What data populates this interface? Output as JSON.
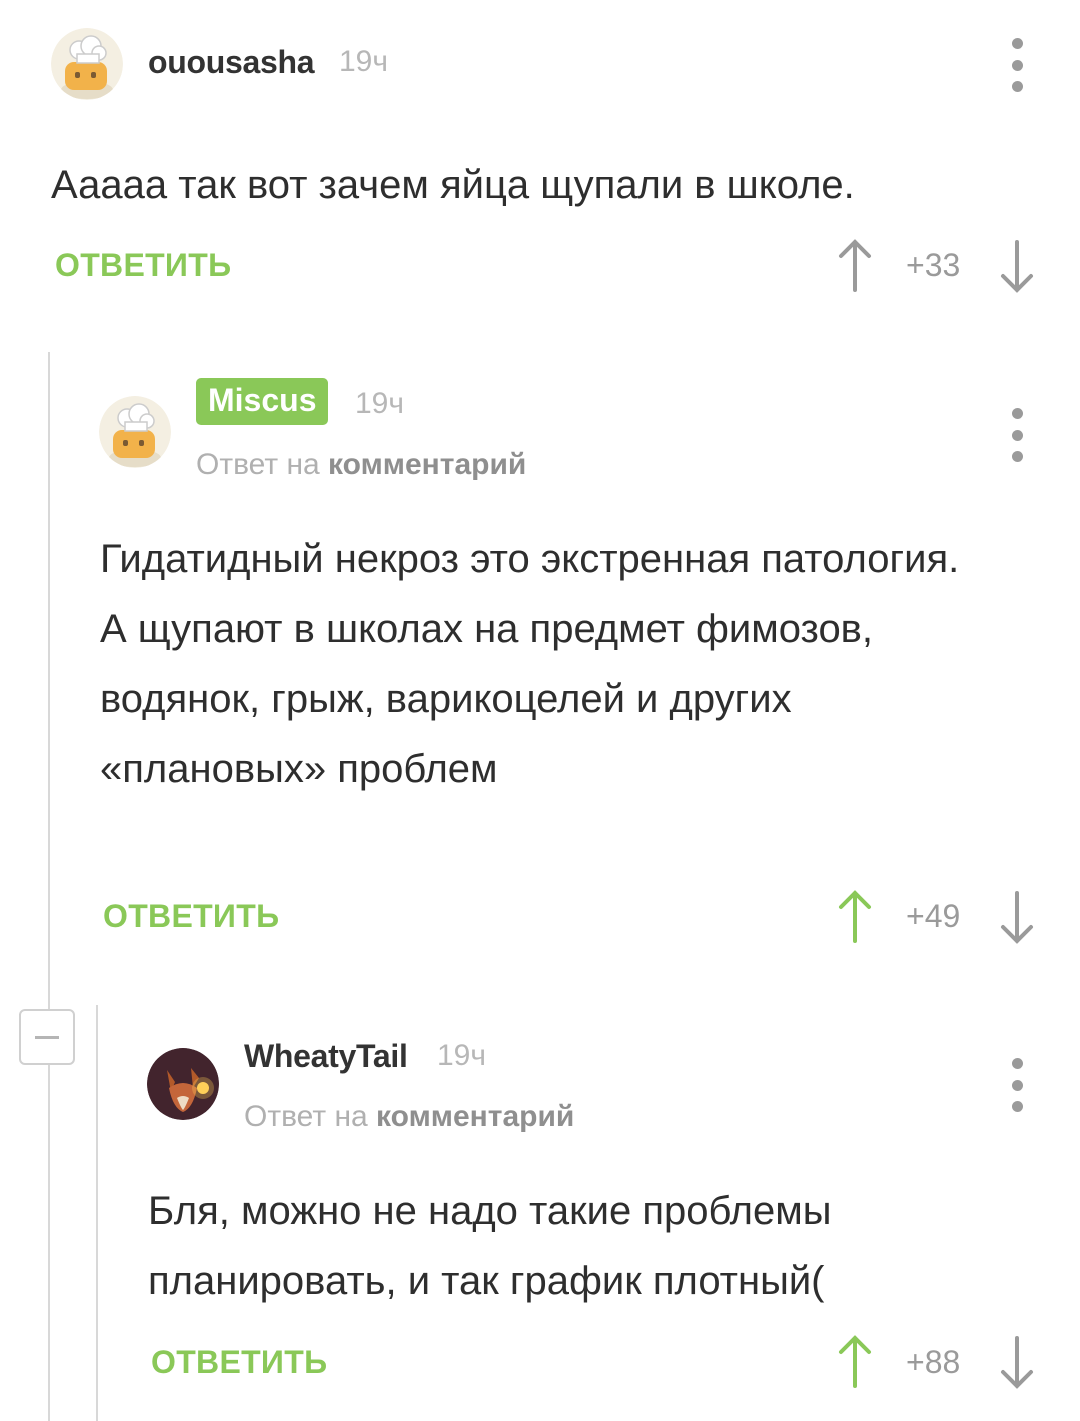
{
  "comments": [
    {
      "author": "ouousasha",
      "time": "19ч",
      "text": "Ааааа так вот зачем яйца щупали в школе.",
      "reply_label": "ОТВЕТИТЬ",
      "rating": "+33",
      "avatar_icon": "chef-hat-avatar"
    },
    {
      "author": "Miscus",
      "time": "19ч",
      "reply_prefix": "Ответ на",
      "reply_link": "комментарий",
      "text": "Гидатидный некроз это экстренная патология. А щупают в школах на предмет фимозов, водянок, грыж, варикоцелей и других «плановых» проблем",
      "reply_label": "ОТВЕТИТЬ",
      "rating": "+49",
      "avatar_icon": "chef-hat-avatar",
      "vote_up_color": "#8ac858"
    },
    {
      "author": "WheatyTail",
      "time": "19ч",
      "reply_prefix": "Ответ на",
      "reply_link": "комментарий",
      "text": "Бля, можно не надо такие проблемы планировать, и так график плотный(",
      "reply_label": "ОТВЕТИТЬ",
      "rating": "+88",
      "avatar_icon": "fox-avatar",
      "vote_up_color": "#8ac858"
    }
  ],
  "colors": {
    "accent": "#8ac858",
    "muted": "#9a9a9a",
    "thread_line": "#d8d8d8"
  }
}
